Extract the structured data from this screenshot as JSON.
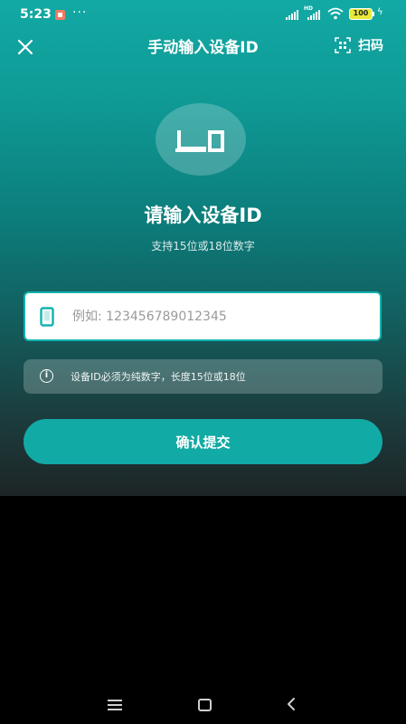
{
  "status_bar": {
    "time": "5:23",
    "more": "···",
    "network_label": "HD",
    "battery": "100"
  },
  "header": {
    "title": "手动输入设备ID",
    "scan_label": "扫码"
  },
  "main": {
    "title": "请输入设备ID",
    "subtitle": "支持15位或18位数字",
    "input": {
      "value": "",
      "placeholder": "例如: 123456789012345"
    },
    "hint": "设备ID必须为纯数字，长度15位或18位",
    "submit_label": "确认提交"
  },
  "icons": {
    "close": "close-icon",
    "scan": "scan-qr-icon",
    "device": "device-screen-icon",
    "input": "phone-icon",
    "info": "info-icon"
  },
  "colors": {
    "accent": "#12aaa4",
    "gradient_top": "#12a9a4",
    "gradient_bottom": "#1d2526"
  }
}
